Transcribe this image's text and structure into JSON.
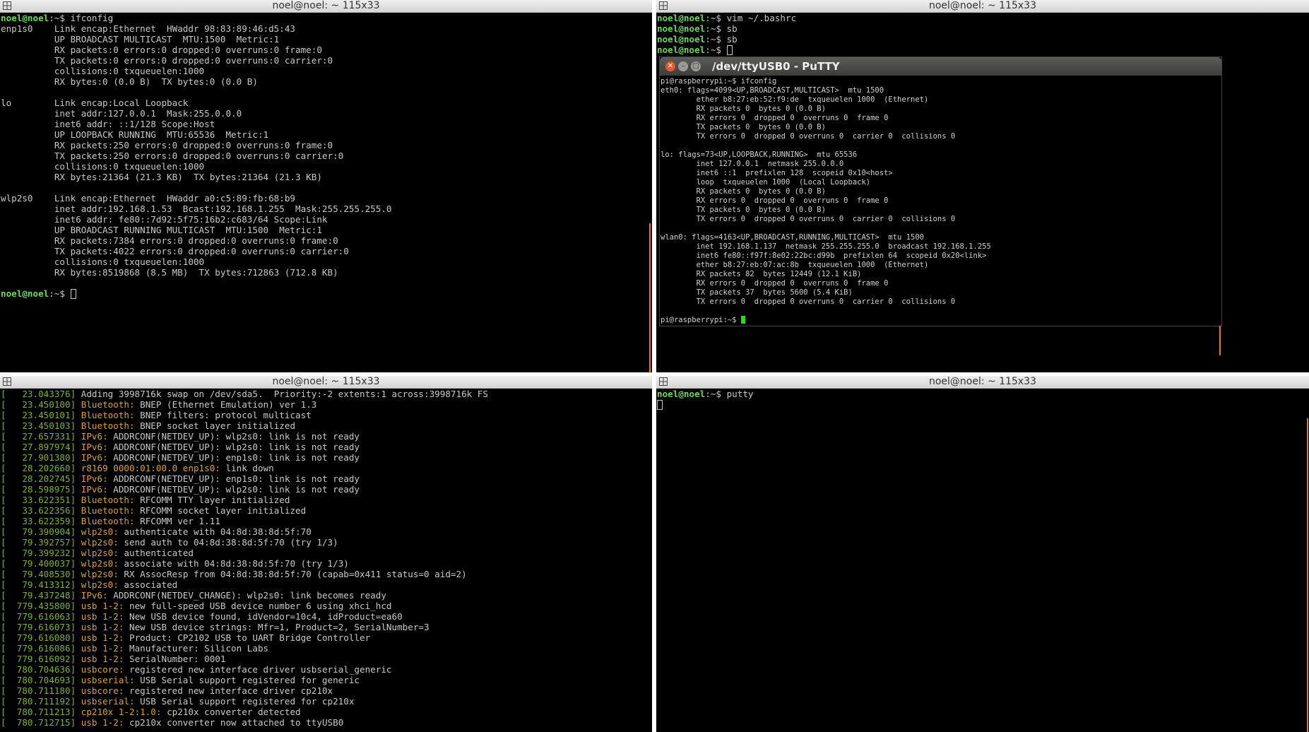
{
  "panes": {
    "top_left": {
      "title": "noel@noel: ~ 115x33",
      "lines": [
        {
          "type": "prompt",
          "user": "noel@noel",
          "path": ":~$ ",
          "cmd": "ifconfig"
        },
        {
          "type": "text",
          "text": "enp1s0    Link encap:Ethernet  HWaddr 98:83:89:46:d5:43"
        },
        {
          "type": "text",
          "text": "          UP BROADCAST MULTICAST  MTU:1500  Metric:1"
        },
        {
          "type": "text",
          "text": "          RX packets:0 errors:0 dropped:0 overruns:0 frame:0"
        },
        {
          "type": "text",
          "text": "          TX packets:0 errors:0 dropped:0 overruns:0 carrier:0"
        },
        {
          "type": "text",
          "text": "          collisions:0 txqueuelen:1000"
        },
        {
          "type": "text",
          "text": "          RX bytes:0 (0.0 B)  TX bytes:0 (0.0 B)"
        },
        {
          "type": "text",
          "text": ""
        },
        {
          "type": "text",
          "text": "lo        Link encap:Local Loopback"
        },
        {
          "type": "text",
          "text": "          inet addr:127.0.0.1  Mask:255.0.0.0"
        },
        {
          "type": "text",
          "text": "          inet6 addr: ::1/128 Scope:Host"
        },
        {
          "type": "text",
          "text": "          UP LOOPBACK RUNNING  MTU:65536  Metric:1"
        },
        {
          "type": "text",
          "text": "          RX packets:250 errors:0 dropped:0 overruns:0 frame:0"
        },
        {
          "type": "text",
          "text": "          TX packets:250 errors:0 dropped:0 overruns:0 carrier:0"
        },
        {
          "type": "text",
          "text": "          collisions:0 txqueuelen:1000"
        },
        {
          "type": "text",
          "text": "          RX bytes:21364 (21.3 KB)  TX bytes:21364 (21.3 KB)"
        },
        {
          "type": "text",
          "text": ""
        },
        {
          "type": "text",
          "text": "wlp2s0    Link encap:Ethernet  HWaddr a0:c5:89:fb:68:b9"
        },
        {
          "type": "text",
          "text": "          inet addr:192.168.1.53  Bcast:192.168.1.255  Mask:255.255.255.0"
        },
        {
          "type": "text",
          "text": "          inet6 addr: fe80::7d92:5f75:16b2:c683/64 Scope:Link"
        },
        {
          "type": "text",
          "text": "          UP BROADCAST RUNNING MULTICAST  MTU:1500  Metric:1"
        },
        {
          "type": "text",
          "text": "          RX packets:7384 errors:0 dropped:0 overruns:0 frame:0"
        },
        {
          "type": "text",
          "text": "          TX packets:4022 errors:0 dropped:0 overruns:0 carrier:0"
        },
        {
          "type": "text",
          "text": "          collisions:0 txqueuelen:1000"
        },
        {
          "type": "text",
          "text": "          RX bytes:8519868 (8.5 MB)  TX bytes:712863 (712.8 KB)"
        },
        {
          "type": "text",
          "text": ""
        },
        {
          "type": "prompt",
          "user": "noel@noel",
          "path": ":~$ ",
          "cmd": "",
          "cursor": true
        }
      ]
    },
    "top_right": {
      "title": "noel@noel: ~ 115x33",
      "lines": [
        {
          "type": "prompt",
          "user": "noel@noel",
          "path": ":~$ ",
          "cmd": "vim ~/.bashrc"
        },
        {
          "type": "prompt",
          "user": "noel@noel",
          "path": ":~$ ",
          "cmd": "sb"
        },
        {
          "type": "prompt",
          "user": "noel@noel",
          "path": ":~$ ",
          "cmd": "sb"
        },
        {
          "type": "prompt",
          "user": "noel@noel",
          "path": ":~$ ",
          "cmd": "",
          "cursor": true
        }
      ]
    },
    "bottom_left": {
      "title": "noel@noel: ~ 115x33",
      "lines": [
        {
          "ts": "[   23.043376]",
          "src": "",
          "msg": " Adding 3998716k swap on /dev/sda5.  Priority:-2 extents:1 across:3998716k FS"
        },
        {
          "ts": "[   23.450100]",
          "src": " Bluetooth:",
          "msg": " BNEP (Ethernet Emulation) ver 1.3"
        },
        {
          "ts": "[   23.450101]",
          "src": " Bluetooth:",
          "msg": " BNEP filters: protocol multicast"
        },
        {
          "ts": "[   23.450103]",
          "src": " Bluetooth:",
          "msg": " BNEP socket layer initialized"
        },
        {
          "ts": "[   27.657331]",
          "src": " IPv6:",
          "msg": " ADDRCONF(NETDEV_UP): wlp2s0: link is not ready"
        },
        {
          "ts": "[   27.897974]",
          "src": " IPv6:",
          "msg": " ADDRCONF(NETDEV_UP): wlp2s0: link is not ready"
        },
        {
          "ts": "[   27.901380]",
          "src": " IPv6:",
          "msg": " ADDRCONF(NETDEV_UP): enp1s0: link is not ready"
        },
        {
          "ts": "[   28.202660]",
          "src": " r8169 0000:01:00.0 enp1s0:",
          "msg": " link down"
        },
        {
          "ts": "[   28.202745]",
          "src": " IPv6:",
          "msg": " ADDRCONF(NETDEV_UP): enp1s0: link is not ready"
        },
        {
          "ts": "[   28.598975]",
          "src": " IPv6:",
          "msg": " ADDRCONF(NETDEV_UP): wlp2s0: link is not ready"
        },
        {
          "ts": "[   33.622351]",
          "src": " Bluetooth:",
          "msg": " RFCOMM TTY layer initialized"
        },
        {
          "ts": "[   33.622356]",
          "src": " Bluetooth:",
          "msg": " RFCOMM socket layer initialized"
        },
        {
          "ts": "[   33.622359]",
          "src": " Bluetooth:",
          "msg": " RFCOMM ver 1.11"
        },
        {
          "ts": "[   79.390904]",
          "src": " wlp2s0:",
          "msg": " authenticate with 04:8d:38:8d:5f:70"
        },
        {
          "ts": "[   79.392757]",
          "src": " wlp2s0:",
          "msg": " send auth to 04:8d:38:8d:5f:70 (try 1/3)"
        },
        {
          "ts": "[   79.399232]",
          "src": " wlp2s0:",
          "msg": " authenticated"
        },
        {
          "ts": "[   79.400037]",
          "src": " wlp2s0:",
          "msg": " associate with 04:8d:38:8d:5f:70 (try 1/3)"
        },
        {
          "ts": "[   79.408530]",
          "src": " wlp2s0:",
          "msg": " RX AssocResp from 04:8d:38:8d:5f:70 (capab=0x411 status=0 aid=2)"
        },
        {
          "ts": "[   79.413312]",
          "src": " wlp2s0:",
          "msg": " associated"
        },
        {
          "ts": "[   79.437248]",
          "src": " IPv6:",
          "msg": " ADDRCONF(NETDEV_CHANGE): wlp2s0: link becomes ready"
        },
        {
          "ts": "[  779.435800]",
          "src": " usb 1-2:",
          "msg": " new full-speed USB device number 6 using xhci_hcd"
        },
        {
          "ts": "[  779.616063]",
          "src": " usb 1-2:",
          "msg": " New USB device found, idVendor=10c4, idProduct=ea60"
        },
        {
          "ts": "[  779.616073]",
          "src": " usb 1-2:",
          "msg": " New USB device strings: Mfr=1, Product=2, SerialNumber=3"
        },
        {
          "ts": "[  779.616080]",
          "src": " usb 1-2:",
          "msg": " Product: CP2102 USB to UART Bridge Controller"
        },
        {
          "ts": "[  779.616086]",
          "src": " usb 1-2:",
          "msg": " Manufacturer: Silicon Labs"
        },
        {
          "ts": "[  779.616092]",
          "src": " usb 1-2:",
          "msg": " SerialNumber: 0001"
        },
        {
          "ts": "[  780.704636]",
          "src": " usbcore:",
          "msg": " registered new interface driver usbserial_generic"
        },
        {
          "ts": "[  780.704693]",
          "src": " usbserial:",
          "msg": " USB Serial support registered for generic"
        },
        {
          "ts": "[  780.711180]",
          "src": " usbcore:",
          "msg": " registered new interface driver cp210x"
        },
        {
          "ts": "[  780.711192]",
          "src": " usbserial:",
          "msg": " USB Serial support registered for cp210x"
        },
        {
          "ts": "[  780.711213]",
          "src": " cp210x 1-2:1.0:",
          "msg": " cp210x converter detected"
        },
        {
          "ts": "[  780.712715]",
          "src": " usb 1-2:",
          "msg": " cp210x converter now attached to ttyUSB0"
        }
      ]
    },
    "bottom_right": {
      "title": "noel@noel: ~ 115x33",
      "lines": [
        {
          "type": "prompt",
          "user": "noel@noel",
          "path": ":~$ ",
          "cmd": "putty"
        },
        {
          "type": "cursoronly"
        }
      ]
    }
  },
  "putty": {
    "title": "/dev/ttyUSB0 - PuTTY",
    "lines": [
      "pi@raspberrypi:~$ ifconfig",
      "eth0: flags=4099<UP,BROADCAST,MULTICAST>  mtu 1500",
      "        ether b8:27:eb:52:f9:de  txqueuelen 1000  (Ethernet)",
      "        RX packets 0  bytes 0 (0.0 B)",
      "        RX errors 0  dropped 0  overruns 0  frame 0",
      "        TX packets 0  bytes 0 (0.0 B)",
      "        TX errors 0  dropped 0 overruns 0  carrier 0  collisions 0",
      "",
      "lo: flags=73<UP,LOOPBACK,RUNNING>  mtu 65536",
      "        inet 127.0.0.1  netmask 255.0.0.0",
      "        inet6 ::1  prefixlen 128  scopeid 0x10<host>",
      "        loop  txqueuelen 1000  (Local Loopback)",
      "        RX packets 0  bytes 0 (0.0 B)",
      "        RX errors 0  dropped 0  overruns 0  frame 0",
      "        TX packets 0  bytes 0 (0.0 B)",
      "        TX errors 0  dropped 0 overruns 0  carrier 0  collisions 0",
      "",
      "wlan0: flags=4163<UP,BROADCAST,RUNNING,MULTICAST>  mtu 1500",
      "        inet 192.168.1.137  netmask 255.255.255.0  broadcast 192.168.1.255",
      "        inet6 fe80::f97f:8e02:22bc:d99b  prefixlen 64  scopeid 0x20<link>",
      "        ether b8:27:eb:07:ac:8b  txqueuelen 1000  (Ethernet)",
      "        RX packets 82  bytes 12449 (12.1 KiB)",
      "        RX errors 0  dropped 0  overruns 0  frame 0",
      "        TX packets 37  bytes 5600 (5.4 KiB)",
      "        TX errors 0  dropped 0 overruns 0  carrier 0  collisions 0",
      "",
      "pi@raspberrypi:~$ "
    ]
  },
  "colors": {
    "prompt_user": "#6cd95d",
    "timestamp": "#7fb22d",
    "source": "#d8a13a",
    "putty_cursor": "#2bd92b"
  }
}
